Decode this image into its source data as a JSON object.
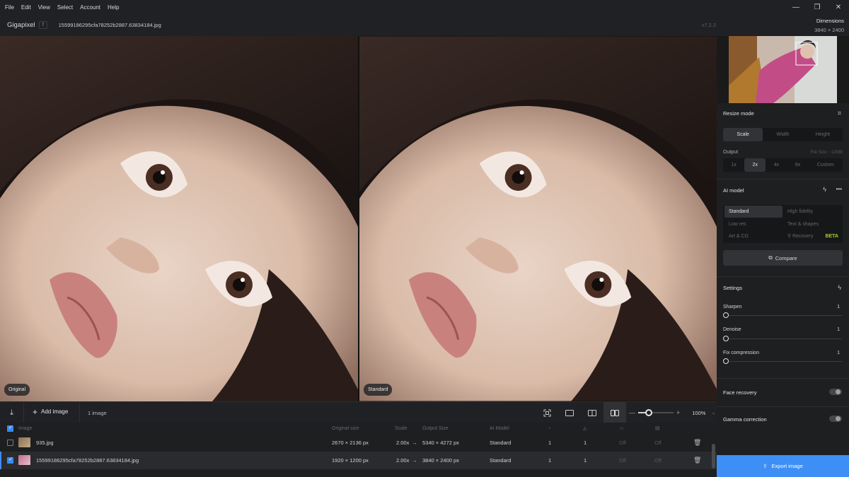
{
  "menu": [
    "File",
    "Edit",
    "View",
    "Select",
    "Account",
    "Help"
  ],
  "window": {
    "minimize": "—",
    "restore": "❐",
    "close": "✕"
  },
  "app": {
    "name": "Gigapixel",
    "badge": "7",
    "filename": "15599186295cfa78252b2887.63834184.jpg",
    "version": "v7.2.2"
  },
  "dimensions": {
    "label": "Dimensions",
    "value": "3840 × 2400"
  },
  "viewer": {
    "left_label": "Original",
    "right_label": "Standard"
  },
  "toolbar": {
    "add_image": "Add image",
    "image_count": "1 image",
    "zoom_value": "100%",
    "zoom_fraction": 0.3
  },
  "table": {
    "headers": {
      "image": "Image",
      "original_size": "Original size",
      "scale": "Scale",
      "output_size": "Output Size",
      "ai_model": "AI Model"
    },
    "rows": [
      {
        "name": "935.jpg",
        "original_size": "2670 × 2136 px",
        "scale": "2.00x",
        "arrow": "→",
        "output_size": "5340 × 4272 px",
        "model": "Standard",
        "c1": "1",
        "c2": "1",
        "c3": "Off",
        "c4": "Off",
        "checked": false
      },
      {
        "name": "15599186295cfa78252b2887.63834184.jpg",
        "original_size": "1920 × 1200 px",
        "scale": "2.00x",
        "arrow": "→",
        "output_size": "3840 × 2400 px",
        "model": "Standard",
        "c1": "1",
        "c2": "1",
        "c3": "Off",
        "c4": "Off",
        "checked": true
      }
    ]
  },
  "sidebar": {
    "resize_mode": {
      "title": "Resize mode",
      "tabs": [
        "Scale",
        "Width",
        "Height"
      ],
      "active": "Scale"
    },
    "output": {
      "label": "Output",
      "file_size": "File Size: ~12MB",
      "options": [
        "1x",
        "2x",
        "4x",
        "6x",
        "Custom"
      ],
      "active": "2x"
    },
    "ai_model": {
      "title": "AI model",
      "more": "•••",
      "models": [
        "Standard",
        "High fidelity",
        "Low res",
        "Text & shapes",
        "Art & CG",
        "Recovery"
      ],
      "active": "Standard",
      "beta": "BETA"
    },
    "compare": "Compare",
    "settings": {
      "title": "Settings",
      "sliders": [
        {
          "label": "Sharpen",
          "value": "1"
        },
        {
          "label": "Denoise",
          "value": "1"
        },
        {
          "label": "Fix compression",
          "value": "1"
        }
      ]
    },
    "face_recovery": "Face recovery",
    "gamma_correction": "Gamma correction",
    "export": "Export image"
  },
  "colors": {
    "accent": "#3d8ff6",
    "beta": "#a5d22e",
    "bg": "#1e1f21"
  }
}
